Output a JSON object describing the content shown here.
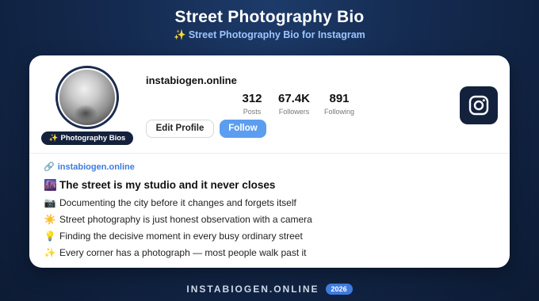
{
  "page": {
    "title": "Street Photography Bio",
    "subtitle_emoji": "✨",
    "subtitle": "Street Photography Bio for Instagram"
  },
  "profile": {
    "avatar_badge_emoji": "✨",
    "avatar_badge": "Photography Bios",
    "username": "instabiogen.online",
    "stats": [
      {
        "value": "312",
        "label": "Posts"
      },
      {
        "value": "67.4K",
        "label": "Followers"
      },
      {
        "value": "891",
        "label": "Following"
      }
    ],
    "edit_profile_label": "Edit Profile",
    "follow_label": "Follow",
    "platform_icon": "instagram-icon"
  },
  "bio": {
    "link_icon": "link-icon",
    "link": "instabiogen.online",
    "headline_emoji": "🌆",
    "headline": "The street is my studio and it never closes",
    "lines": [
      {
        "emoji": "📷",
        "text": "Documenting the city before it changes and forgets itself"
      },
      {
        "emoji": "☀️",
        "text": "Street photography is just honest observation with a camera"
      },
      {
        "emoji": "💡",
        "text": "Finding the decisive moment in every busy ordinary street"
      },
      {
        "emoji": "✨",
        "text": "Every corner has a photograph — most people walk past it"
      }
    ]
  },
  "footer": {
    "text": "INSTABIOGEN.ONLINE",
    "year": "2026"
  },
  "colors": {
    "background": "#142a4f",
    "accent": "#5b9ef0",
    "link": "#3d7be0",
    "dark_badge": "#14213d"
  }
}
